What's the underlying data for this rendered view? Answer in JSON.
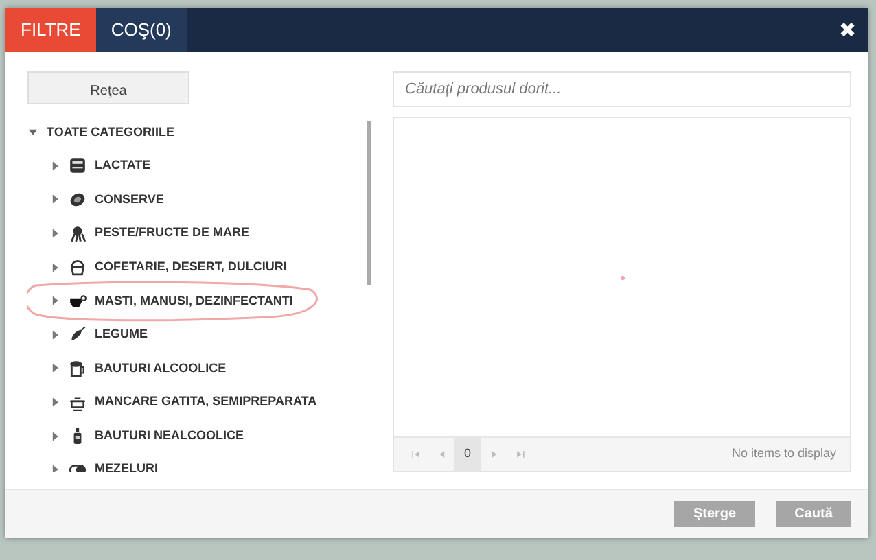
{
  "tabs": [
    {
      "label": "FILTRE",
      "selected": true
    },
    {
      "label": "COŞ(0)",
      "selected": false
    }
  ],
  "close": "✖",
  "network_button": "Reţea",
  "tree": {
    "label": "TOATE CATEGORIILE",
    "expanded": true,
    "children": [
      {
        "label": "LACTATE",
        "expanded": false
      },
      {
        "label": "CONSERVE",
        "expanded": false
      },
      {
        "label": "PESTE/FRUCTE DE MARE",
        "expanded": false
      },
      {
        "label": "COFETARIE, DESERT, DULCIURI",
        "expanded": false
      },
      {
        "label": "MASTI, MANUSI, DEZINFECTANTI",
        "expanded": false,
        "circled": true
      },
      {
        "label": "LEGUME",
        "expanded": false
      },
      {
        "label": "BAUTURI ALCOOLICE",
        "expanded": false
      },
      {
        "label": "MANCARE GATITA, SEMIPREPARATA",
        "expanded": false
      },
      {
        "label": "BAUTURI NEALCOOLICE",
        "expanded": false
      },
      {
        "label": "MEZELURI",
        "expanded": false
      }
    ]
  },
  "search": {
    "placeholder": "Căutaţi produsul dorit..."
  },
  "pager": {
    "page": "0",
    "status": "No items to display"
  },
  "buttons": [
    "Şterge",
    "Caută"
  ]
}
